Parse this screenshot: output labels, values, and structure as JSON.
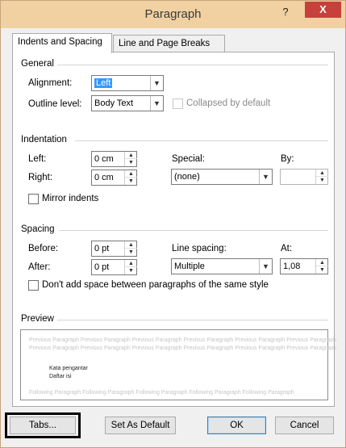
{
  "window": {
    "title": "Paragraph",
    "help_glyph": "?",
    "close_glyph": "X"
  },
  "tabs": [
    {
      "label": "Indents and Spacing",
      "active": true
    },
    {
      "label": "Line and Page Breaks",
      "active": false
    }
  ],
  "general": {
    "heading": "General",
    "alignment_label": "Alignment:",
    "alignment_value": "Left",
    "outline_label": "Outline level:",
    "outline_value": "Body Text",
    "collapsed_label": "Collapsed by default"
  },
  "indentation": {
    "heading": "Indentation",
    "left_label": "Left:",
    "left_value": "0 cm",
    "right_label": "Right:",
    "right_value": "0 cm",
    "special_label": "Special:",
    "special_value": "(none)",
    "by_label": "By:",
    "by_value": "",
    "mirror_label": "Mirror indents"
  },
  "spacing": {
    "heading": "Spacing",
    "before_label": "Before:",
    "before_value": "0 pt",
    "after_label": "After:",
    "after_value": "0 pt",
    "line_spacing_label": "Line spacing:",
    "line_spacing_value": "Multiple",
    "at_label": "At:",
    "at_value": "1,08",
    "dont_add_label": "Don't add space between paragraphs of the same style"
  },
  "preview": {
    "heading": "Preview",
    "prev_line_1": "Previous Paragraph Previous Paragraph Previous Paragraph Previous Paragraph Previous Paragraph Previous Paragraph",
    "prev_line_2": "Previous Paragraph Previous Paragraph Previous Paragraph Previous Paragraph Previous Paragraph Previous Paragraph",
    "main_line_1": "Kata pengantar",
    "main_line_2": "Daftar isi",
    "follow_line": "Following Paragraph Following Paragraph Following Paragraph Following Paragraph Following Paragraph"
  },
  "buttons": {
    "tabs": "Tabs...",
    "set_default": "Set As Default",
    "ok": "OK",
    "cancel": "Cancel"
  },
  "colors": {
    "titlebar": "#f1d1a2",
    "close": "#c7403b",
    "highlight": "#3399ff"
  }
}
